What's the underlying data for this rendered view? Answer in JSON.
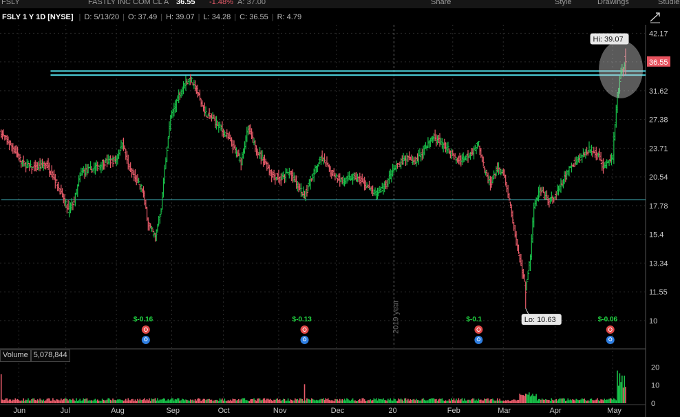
{
  "topbar": {
    "symbol": "FSLY",
    "company": "FASTLY INC COM CL A",
    "last": "36.55",
    "change_pct": "-1.48%",
    "ask": "A: 37.00",
    "share": "Share",
    "style": "Style",
    "drawings": "Drawings",
    "studies": "Studies"
  },
  "info": {
    "symbol": "FSLY 1 Y 1D [NYSE]",
    "date": "D: 5/13/20",
    "open": "O: 37.49",
    "high": "H: 39.07",
    "low": "L: 34.28",
    "close": "C: 36.55",
    "range": "R: 4.79"
  },
  "volume_panel": {
    "label": "Volume",
    "value": "5,078,844"
  },
  "colors": {
    "up": "#19c24a",
    "down": "#e85c6a",
    "level": "#4ed3de",
    "grid": "#2a2a2a",
    "price_tag": "#e8535f"
  },
  "chart_data": {
    "type": "ohlc",
    "title": "FSLY 1 Y 1D [NYSE]",
    "ylim": [
      8.8,
      44
    ],
    "y_ticks": [
      "42.17",
      "36.55",
      "31.62",
      "27.38",
      "23.71",
      "20.54",
      "17.78",
      "15.4",
      "13.34",
      "11.55",
      "10"
    ],
    "y_tick_values": [
      42.17,
      36.55,
      31.62,
      27.38,
      23.71,
      20.54,
      17.78,
      15.4,
      13.34,
      11.55,
      10
    ],
    "x_labels": [
      "Jun",
      "Jul",
      "Aug",
      "Sep",
      "Oct",
      "Nov",
      "Dec",
      "20",
      "Feb",
      "Mar",
      "Apr",
      "May"
    ],
    "x_label_days": [
      15,
      55,
      98,
      145,
      189,
      236,
      285,
      334,
      384,
      427,
      471,
      520
    ],
    "last_price_label": "36.55",
    "year_marker": "2019 year",
    "year_marker_day": 334,
    "hi_label": "Hi: 39.07",
    "lo_label": "Lo: 10.63",
    "levels": [
      {
        "price": 34.9,
        "from_day": 42
      },
      {
        "price": 34.2,
        "from_day": 42
      },
      {
        "price": 18.3,
        "from_day": 0
      }
    ],
    "earnings": [
      {
        "day": 123,
        "label": "$-0.16"
      },
      {
        "day": 258,
        "label": "$-0.13"
      },
      {
        "day": 406,
        "label": "$-0.1"
      },
      {
        "day": 518,
        "label": "$-0.06"
      }
    ],
    "volume_ticks": [
      "20",
      "10",
      "0"
    ],
    "volume_tick_values": [
      20,
      10,
      0
    ],
    "volume_ylim": [
      0,
      22
    ],
    "anchors": [
      {
        "d": 0,
        "p": 25.5
      },
      {
        "d": 10,
        "p": 23.8
      },
      {
        "d": 18,
        "p": 22
      },
      {
        "d": 28,
        "p": 21.4
      },
      {
        "d": 38,
        "p": 21.9
      },
      {
        "d": 45,
        "p": 20.5
      },
      {
        "d": 52,
        "p": 18.6
      },
      {
        "d": 57,
        "p": 17.4
      },
      {
        "d": 62,
        "p": 18.2
      },
      {
        "d": 68,
        "p": 21
      },
      {
        "d": 78,
        "p": 21.4
      },
      {
        "d": 88,
        "p": 22.1
      },
      {
        "d": 98,
        "p": 22.4
      },
      {
        "d": 103,
        "p": 24.6
      },
      {
        "d": 108,
        "p": 21.6
      },
      {
        "d": 114,
        "p": 20.3
      },
      {
        "d": 120,
        "p": 19.3
      },
      {
        "d": 125,
        "p": 16.2
      },
      {
        "d": 131,
        "p": 15.2
      },
      {
        "d": 136,
        "p": 17.5
      },
      {
        "d": 140,
        "p": 22.5
      },
      {
        "d": 144,
        "p": 27.5
      },
      {
        "d": 150,
        "p": 30.5
      },
      {
        "d": 156,
        "p": 32.8
      },
      {
        "d": 161,
        "p": 33.6
      },
      {
        "d": 167,
        "p": 31.3
      },
      {
        "d": 173,
        "p": 28.3
      },
      {
        "d": 180,
        "p": 27.5
      },
      {
        "d": 186,
        "p": 26.3
      },
      {
        "d": 192,
        "p": 25.2
      },
      {
        "d": 198,
        "p": 23.6
      },
      {
        "d": 204,
        "p": 22.2
      },
      {
        "d": 210,
        "p": 26.2
      },
      {
        "d": 217,
        "p": 23.5
      },
      {
        "d": 224,
        "p": 22.2
      },
      {
        "d": 230,
        "p": 20.8
      },
      {
        "d": 238,
        "p": 20.3
      },
      {
        "d": 245,
        "p": 21.1
      },
      {
        "d": 252,
        "p": 19.6
      },
      {
        "d": 258,
        "p": 18.7
      },
      {
        "d": 265,
        "p": 20.8
      },
      {
        "d": 272,
        "p": 22.6
      },
      {
        "d": 280,
        "p": 21.2
      },
      {
        "d": 290,
        "p": 20.1
      },
      {
        "d": 300,
        "p": 20.6
      },
      {
        "d": 310,
        "p": 19.7
      },
      {
        "d": 318,
        "p": 18.8
      },
      {
        "d": 326,
        "p": 19.6
      },
      {
        "d": 334,
        "p": 21.3
      },
      {
        "d": 344,
        "p": 22.6
      },
      {
        "d": 352,
        "p": 22.1
      },
      {
        "d": 360,
        "p": 23.7
      },
      {
        "d": 367,
        "p": 25.1
      },
      {
        "d": 374,
        "p": 24.3
      },
      {
        "d": 380,
        "p": 23.6
      },
      {
        "d": 387,
        "p": 22.3
      },
      {
        "d": 393,
        "p": 22.6
      },
      {
        "d": 400,
        "p": 23.2
      },
      {
        "d": 406,
        "p": 24.3
      },
      {
        "d": 411,
        "p": 21.2
      },
      {
        "d": 416,
        "p": 19.8
      },
      {
        "d": 421,
        "p": 21.3
      },
      {
        "d": 427,
        "p": 20.9
      },
      {
        "d": 432,
        "p": 18.2
      },
      {
        "d": 437,
        "p": 15.3
      },
      {
        "d": 442,
        "p": 13.2
      },
      {
        "d": 446,
        "p": 11.6
      },
      {
        "d": 450,
        "p": 13.8
      },
      {
        "d": 453,
        "p": 17.6
      },
      {
        "d": 458,
        "p": 19.2
      },
      {
        "d": 464,
        "p": 18.3
      },
      {
        "d": 470,
        "p": 18.4
      },
      {
        "d": 476,
        "p": 19.6
      },
      {
        "d": 484,
        "p": 21.6
      },
      {
        "d": 492,
        "p": 22.6
      },
      {
        "d": 500,
        "p": 23.6
      },
      {
        "d": 508,
        "p": 23.1
      },
      {
        "d": 512,
        "p": 21.4
      },
      {
        "d": 516,
        "p": 22.1
      },
      {
        "d": 520,
        "p": 22.8
      },
      {
        "d": 524,
        "p": 31.0
      },
      {
        "d": 527,
        "p": 34.2
      },
      {
        "d": 531,
        "p": 36.55
      }
    ]
  }
}
